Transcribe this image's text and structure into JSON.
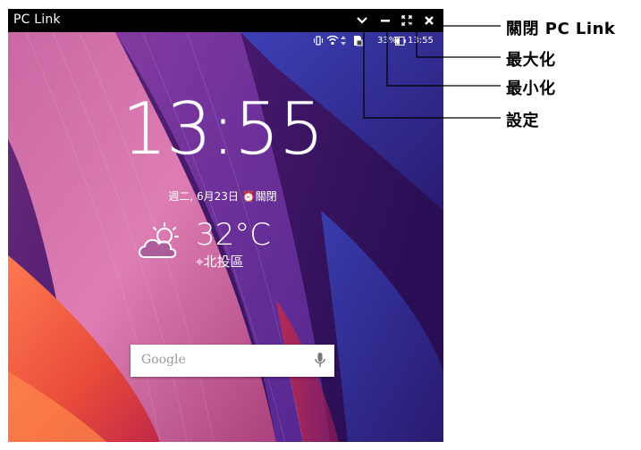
{
  "window": {
    "title": "PC Link"
  },
  "statusbar": {
    "battery_text": "33%",
    "time": "13:55"
  },
  "lockscreen": {
    "clock": "13:55",
    "date": "週二, 6月23日 ⏰關閉",
    "weather_temp": "32°C",
    "weather_location": "⌖北投區"
  },
  "search": {
    "placeholder": "Google"
  },
  "callouts": {
    "close": "關閉 PC Link",
    "maximize": "最大化",
    "minimize": "最小化",
    "settings": "設定"
  },
  "icons": {
    "settings": "chevron-down-icon",
    "minimize": "minimize-icon",
    "maximize": "maximize-icon",
    "close": "close-icon"
  }
}
